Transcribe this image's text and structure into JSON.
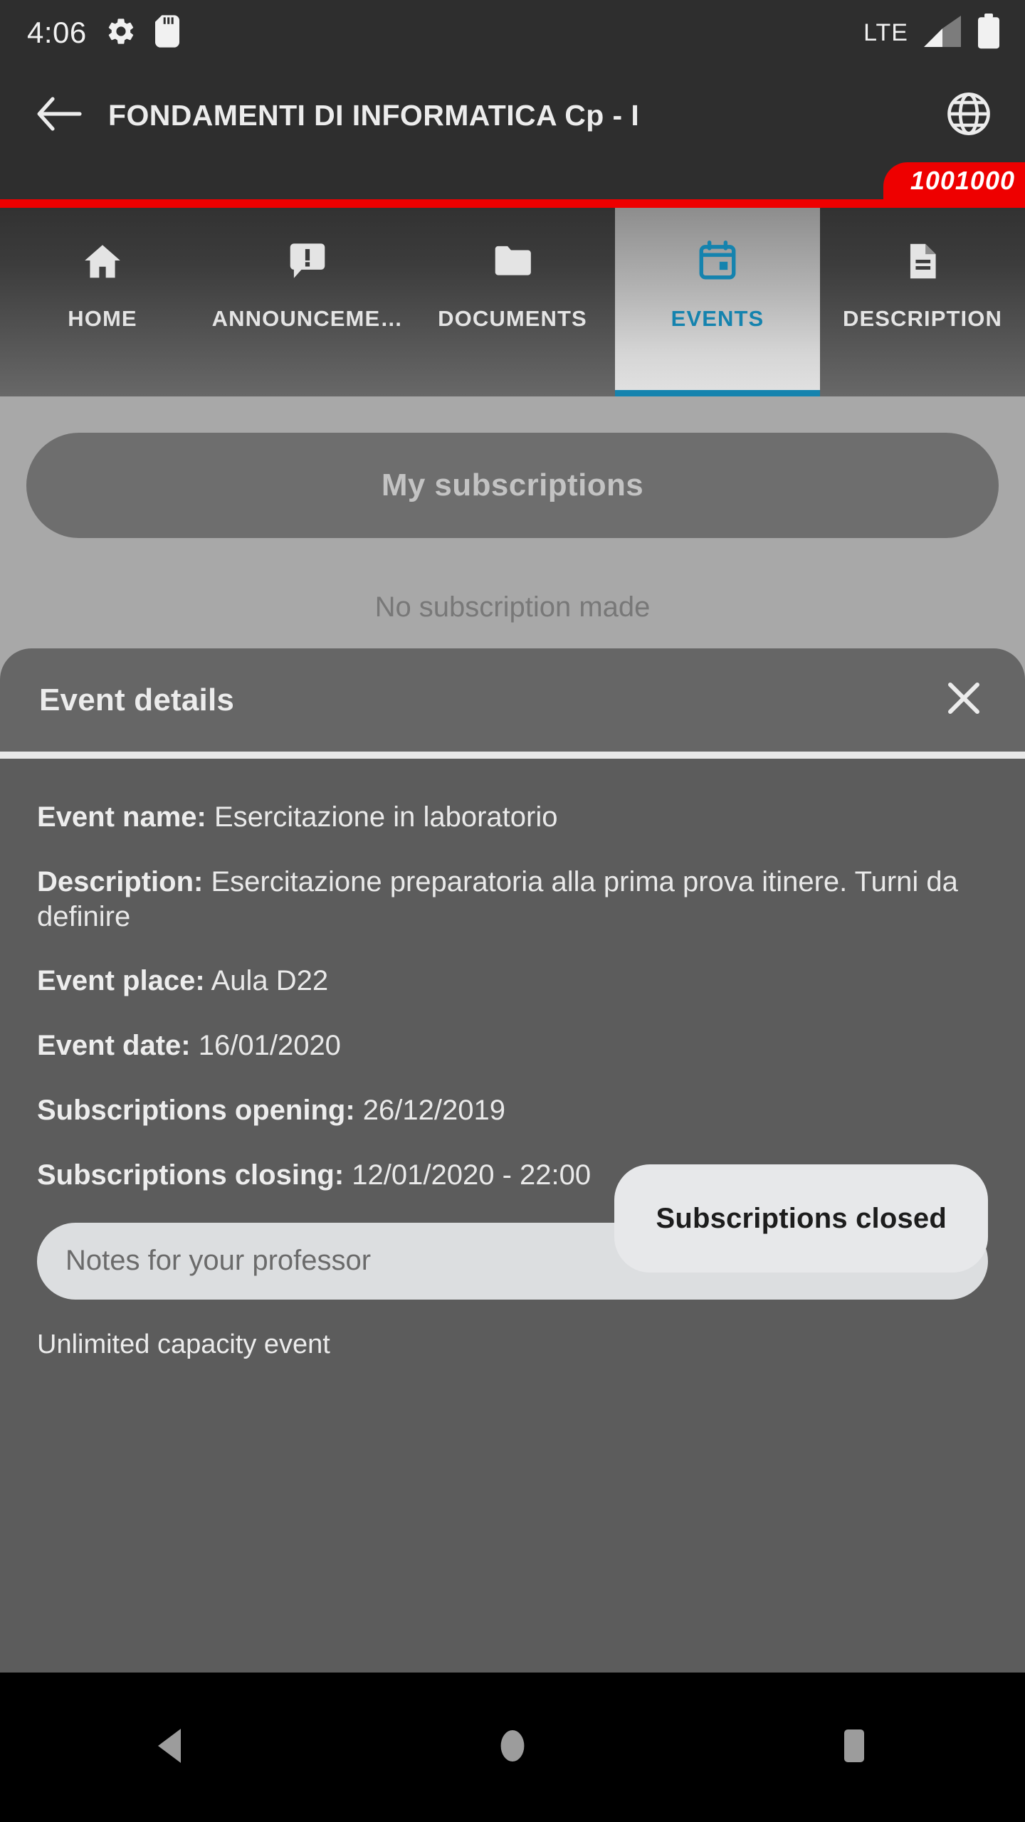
{
  "status_bar": {
    "clock": "4:06",
    "network_label": "LTE",
    "icons": [
      "settings-gear-icon",
      "sd-card-icon",
      "signal-bars-icon",
      "battery-icon"
    ]
  },
  "app_bar": {
    "back_label": "back-arrow-icon",
    "title": "FONDAMENTI DI INFORMATICA Cp - I",
    "language_icon": "globe-icon",
    "badge": "1001000",
    "accent_red": "#ee0000"
  },
  "tabs": {
    "accent": "#1583ae",
    "items": [
      {
        "label": "HOME",
        "icon": "home-icon",
        "active": false
      },
      {
        "label": "ANNOUNCEME…",
        "icon": "announcement-icon",
        "active": false
      },
      {
        "label": "DOCUMENTS",
        "icon": "folder-icon",
        "active": false
      },
      {
        "label": "EVENTS",
        "icon": "calendar-icon",
        "active": true
      },
      {
        "label": "DESCRIPTION",
        "icon": "document-icon",
        "active": false
      }
    ]
  },
  "page": {
    "my_subscriptions_button": "My subscriptions",
    "empty_state": "No subscription made"
  },
  "modal": {
    "title": "Event details",
    "close_icon": "close-icon",
    "fields": [
      {
        "key": "Event name:",
        "value": "Esercitazione in laboratorio"
      },
      {
        "key": "Description:",
        "value": "Esercitazione preparatoria alla prima prova itinere. Turni da definire"
      },
      {
        "key": "Event place:",
        "value": "Aula D22"
      },
      {
        "key": "Event date:",
        "value": "16/01/2020"
      },
      {
        "key": "Subscriptions opening:",
        "value": "26/12/2019"
      },
      {
        "key": "Subscriptions closing:",
        "value": "12/01/2020 - 22:00"
      }
    ],
    "notes_placeholder": "Notes for your professor",
    "notes_value": "",
    "capacity_note": "Unlimited capacity event",
    "cta_label": "Subscriptions closed"
  },
  "nav_bar": {
    "back": "nav-back-icon",
    "home": "nav-home-icon",
    "recents": "nav-recents-icon"
  }
}
